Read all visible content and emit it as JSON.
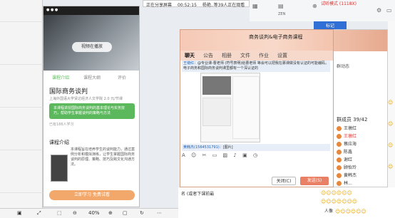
{
  "share": {
    "sharing": "正在分享屏幕",
    "timer": "00:52:15",
    "viewers": "杨艳..等39人正在观看"
  },
  "top_toolbar": {
    "badge": "试听模式 (1118X)",
    "zen": "ZEN"
  },
  "phone": {
    "video_label": "视频在播放",
    "tabs": [
      "课程介绍",
      "课程大纲",
      "评价"
    ],
    "course_title": "国际商务谈判",
    "course_sub": "上海外国语大学贤达经济人文学院  2.0 元/节课",
    "highlight": "本课程讲授国际商务谈判的基本理论与实务技巧，帮助学生掌握谈判的策略与方法",
    "note": "已有186人学习",
    "intro_title": "课程介绍",
    "intro_text": "本课程旨在培养学生的谈判能力，通过案例分析和模拟演练，让学生掌握国际商务谈判的原理、策略、技巧及跨文化沟通方法。",
    "footer_btn": "立即学习  免费试看"
  },
  "bottom_bar": {
    "zoom": "40%"
  },
  "chat": {
    "title": "商务谈判&电子商务课程",
    "tabs": [
      "聊天",
      "公告",
      "相册",
      "文件",
      "作业",
      "设置"
    ],
    "message_sender": "王墩红：",
    "message_text": "@专业课-曹老师 (符号表明)给曹老师 等会可以把我在慕课做没有认证的可能编码，电子商务和国际商务谈判课里都有一个深认证的",
    "caption_sender": "黄韩杰(1564531791)：",
    "caption_text": "[图片]",
    "close_button": "关闭(C)",
    "send_button": "发送(S)"
  },
  "side_panel": {
    "new_circle": "群动态",
    "members_title": "群成员 39/42",
    "members": [
      "王墩红",
      "王墩红",
      "蔡应海",
      "陈鑫",
      "谢红",
      "顾怡玲",
      "黄韩杰",
      "林..."
    ]
  },
  "blue_tag": "标记",
  "below": {
    "text": "名 (或者下课前最",
    "user_label": "人像"
  }
}
